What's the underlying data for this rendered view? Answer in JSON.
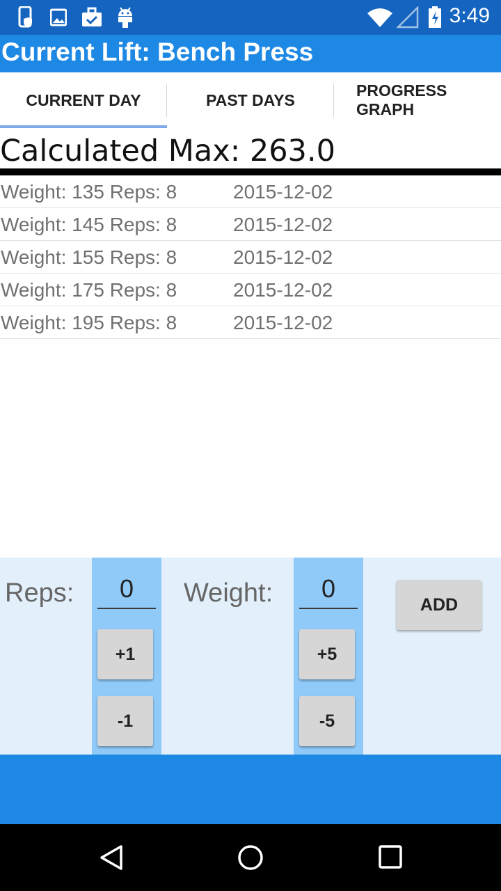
{
  "status_bar": {
    "time": "3:49",
    "icons": [
      "phone-shield-icon",
      "image-icon",
      "briefcase-check-icon",
      "android-icon",
      "wifi-icon",
      "signal-icon",
      "battery-charging-icon"
    ]
  },
  "app_bar": {
    "title": "Current Lift: Bench Press"
  },
  "tabs": [
    {
      "label": "CURRENT DAY",
      "selected": true
    },
    {
      "label": "PAST DAYS",
      "selected": false
    },
    {
      "label": "PROGRESS GRAPH",
      "selected": false
    }
  ],
  "calculated_max": "Calculated Max: 263.0",
  "entries": [
    {
      "text": "Weight: 135 Reps: 8",
      "date": "2015-12-02"
    },
    {
      "text": "Weight: 145 Reps: 8",
      "date": "2015-12-02"
    },
    {
      "text": "Weight: 155 Reps: 8",
      "date": "2015-12-02"
    },
    {
      "text": "Weight: 175 Reps: 8",
      "date": "2015-12-02"
    },
    {
      "text": "Weight: 195 Reps: 8",
      "date": "2015-12-02"
    }
  ],
  "input": {
    "reps_label": "Reps:",
    "reps_value": "0",
    "reps_plus": "+1",
    "reps_minus": "-1",
    "weight_label": "Weight:",
    "weight_value": "0",
    "weight_plus": "+5",
    "weight_minus": "-5",
    "add_label": "ADD"
  },
  "colors": {
    "status_bar": "#1565c0",
    "app_bar": "#1e88e5",
    "panel": "#e3f0fb",
    "stepper_column": "#90caf9"
  }
}
